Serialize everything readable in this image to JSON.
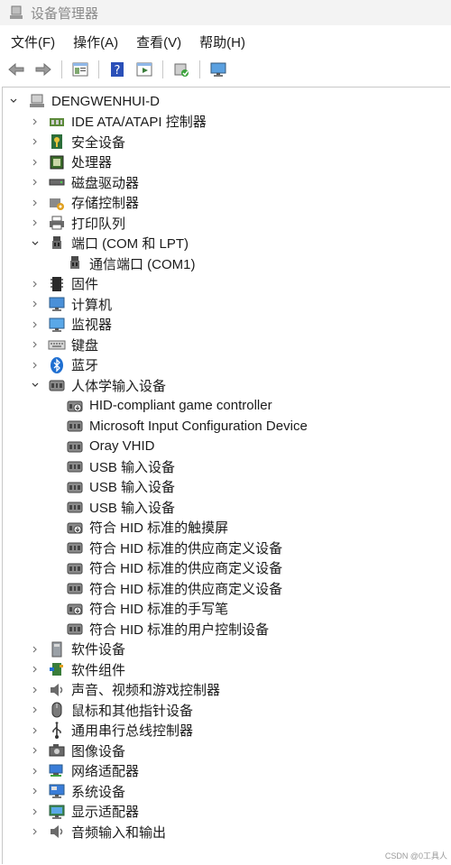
{
  "window": {
    "title": "设备管理器"
  },
  "menu": [
    "文件(F)",
    "操作(A)",
    "查看(V)",
    "帮助(H)"
  ],
  "toolbar": [
    "back-icon",
    "forward-icon",
    "properties-icon",
    "help-icon",
    "run-icon",
    "scan-hardware-icon",
    "computer-screen-icon"
  ],
  "root": "DENGWENHUI-D",
  "tree": [
    {
      "label": "IDE ATA/ATAPI 控制器",
      "level": 1,
      "expand": "collapsed",
      "icon": "ide-controller-icon"
    },
    {
      "label": "安全设备",
      "level": 1,
      "expand": "collapsed",
      "icon": "security-key-icon"
    },
    {
      "label": "处理器",
      "level": 1,
      "expand": "collapsed",
      "icon": "processor-icon"
    },
    {
      "label": "磁盘驱动器",
      "level": 1,
      "expand": "collapsed",
      "icon": "disk-drive-icon"
    },
    {
      "label": "存储控制器",
      "level": 1,
      "expand": "collapsed",
      "icon": "storage-controller-icon"
    },
    {
      "label": "打印队列",
      "level": 1,
      "expand": "collapsed",
      "icon": "printer-icon"
    },
    {
      "label": "端口 (COM 和 LPT)",
      "level": 1,
      "expand": "expanded",
      "icon": "port-icon"
    },
    {
      "label": "通信端口 (COM1)",
      "level": 2,
      "expand": "none",
      "icon": "port-icon"
    },
    {
      "label": "固件",
      "level": 1,
      "expand": "collapsed",
      "icon": "firmware-icon"
    },
    {
      "label": "计算机",
      "level": 1,
      "expand": "collapsed",
      "icon": "computer-icon"
    },
    {
      "label": "监视器",
      "level": 1,
      "expand": "collapsed",
      "icon": "monitor-icon"
    },
    {
      "label": "键盘",
      "level": 1,
      "expand": "collapsed",
      "icon": "keyboard-icon"
    },
    {
      "label": "蓝牙",
      "level": 1,
      "expand": "collapsed",
      "icon": "bluetooth-icon"
    },
    {
      "label": "人体学输入设备",
      "level": 1,
      "expand": "expanded",
      "icon": "hid-icon"
    },
    {
      "label": "HID-compliant game controller",
      "level": 2,
      "expand": "none",
      "icon": "hid-download-icon"
    },
    {
      "label": "Microsoft Input Configuration Device",
      "level": 2,
      "expand": "none",
      "icon": "hid-icon"
    },
    {
      "label": "Oray VHID",
      "level": 2,
      "expand": "none",
      "icon": "hid-icon"
    },
    {
      "label": "USB 输入设备",
      "level": 2,
      "expand": "none",
      "icon": "hid-icon"
    },
    {
      "label": "USB 输入设备",
      "level": 2,
      "expand": "none",
      "icon": "hid-icon"
    },
    {
      "label": "USB 输入设备",
      "level": 2,
      "expand": "none",
      "icon": "hid-icon"
    },
    {
      "label": "符合 HID 标准的触摸屏",
      "level": 2,
      "expand": "none",
      "icon": "hid-download-icon"
    },
    {
      "label": "符合 HID 标准的供应商定义设备",
      "level": 2,
      "expand": "none",
      "icon": "hid-icon"
    },
    {
      "label": "符合 HID 标准的供应商定义设备",
      "level": 2,
      "expand": "none",
      "icon": "hid-icon"
    },
    {
      "label": "符合 HID 标准的供应商定义设备",
      "level": 2,
      "expand": "none",
      "icon": "hid-icon"
    },
    {
      "label": "符合 HID 标准的手写笔",
      "level": 2,
      "expand": "none",
      "icon": "hid-download-icon"
    },
    {
      "label": "符合 HID 标准的用户控制设备",
      "level": 2,
      "expand": "none",
      "icon": "hid-icon"
    },
    {
      "label": "软件设备",
      "level": 1,
      "expand": "collapsed",
      "icon": "software-device-icon"
    },
    {
      "label": "软件组件",
      "level": 1,
      "expand": "collapsed",
      "icon": "software-component-icon"
    },
    {
      "label": "声音、视频和游戏控制器",
      "level": 1,
      "expand": "collapsed",
      "icon": "speaker-icon"
    },
    {
      "label": "鼠标和其他指针设备",
      "level": 1,
      "expand": "collapsed",
      "icon": "mouse-icon"
    },
    {
      "label": "通用串行总线控制器",
      "level": 1,
      "expand": "collapsed",
      "icon": "usb-icon"
    },
    {
      "label": "图像设备",
      "level": 1,
      "expand": "collapsed",
      "icon": "camera-icon"
    },
    {
      "label": "网络适配器",
      "level": 1,
      "expand": "collapsed",
      "icon": "network-adapter-icon"
    },
    {
      "label": "系统设备",
      "level": 1,
      "expand": "collapsed",
      "icon": "system-device-icon"
    },
    {
      "label": "显示适配器",
      "level": 1,
      "expand": "collapsed",
      "icon": "display-adapter-icon"
    },
    {
      "label": "音频输入和输出",
      "level": 1,
      "expand": "collapsed",
      "icon": "audio-io-icon"
    }
  ],
  "watermark": "CSDN @0工具人"
}
